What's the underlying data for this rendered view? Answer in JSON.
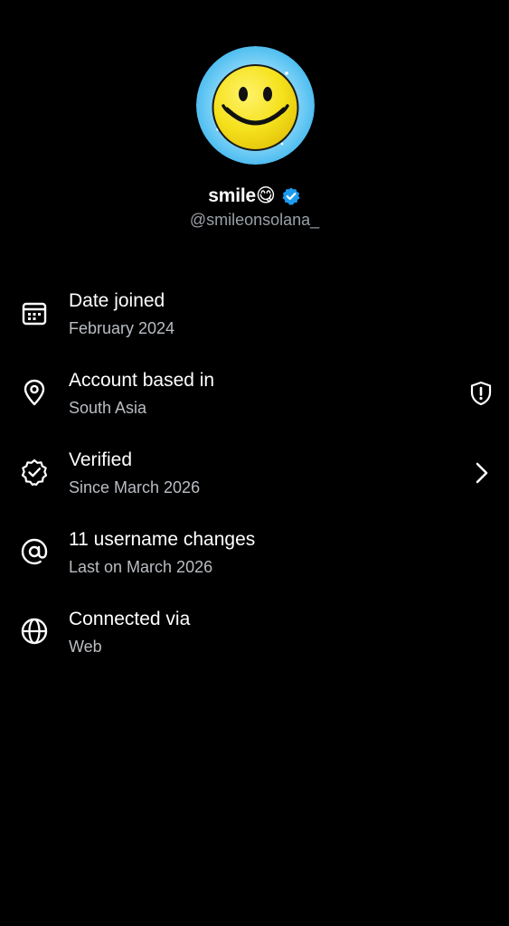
{
  "profile": {
    "display_name": "smile😋",
    "handle": "@smileonsolana_",
    "avatar_icon": "smiley-face-avatar",
    "verified_icon": "verified-badge-icon",
    "verified_color": "#1d9bf0"
  },
  "info": [
    {
      "icon": "calendar-icon",
      "title": "Date joined",
      "subtitle": "February 2024"
    },
    {
      "icon": "location-pin-icon",
      "title": "Account based in",
      "subtitle": "South Asia",
      "trailing_icon": "shield-alert-icon"
    },
    {
      "icon": "verified-outline-icon",
      "title": "Verified",
      "subtitle": "Since March 2026",
      "trailing_icon": "chevron-right-icon"
    },
    {
      "icon": "at-sign-icon",
      "title": "11 username changes",
      "subtitle": "Last on March 2026"
    },
    {
      "icon": "globe-icon",
      "title": "Connected via",
      "subtitle": "Web"
    }
  ],
  "colors": {
    "background": "#000000",
    "text_primary": "#ffffff",
    "text_secondary": "#b9bdc2",
    "avatar_bg": "#5ec6f2",
    "smiley_yellow": "#f5e11c"
  }
}
